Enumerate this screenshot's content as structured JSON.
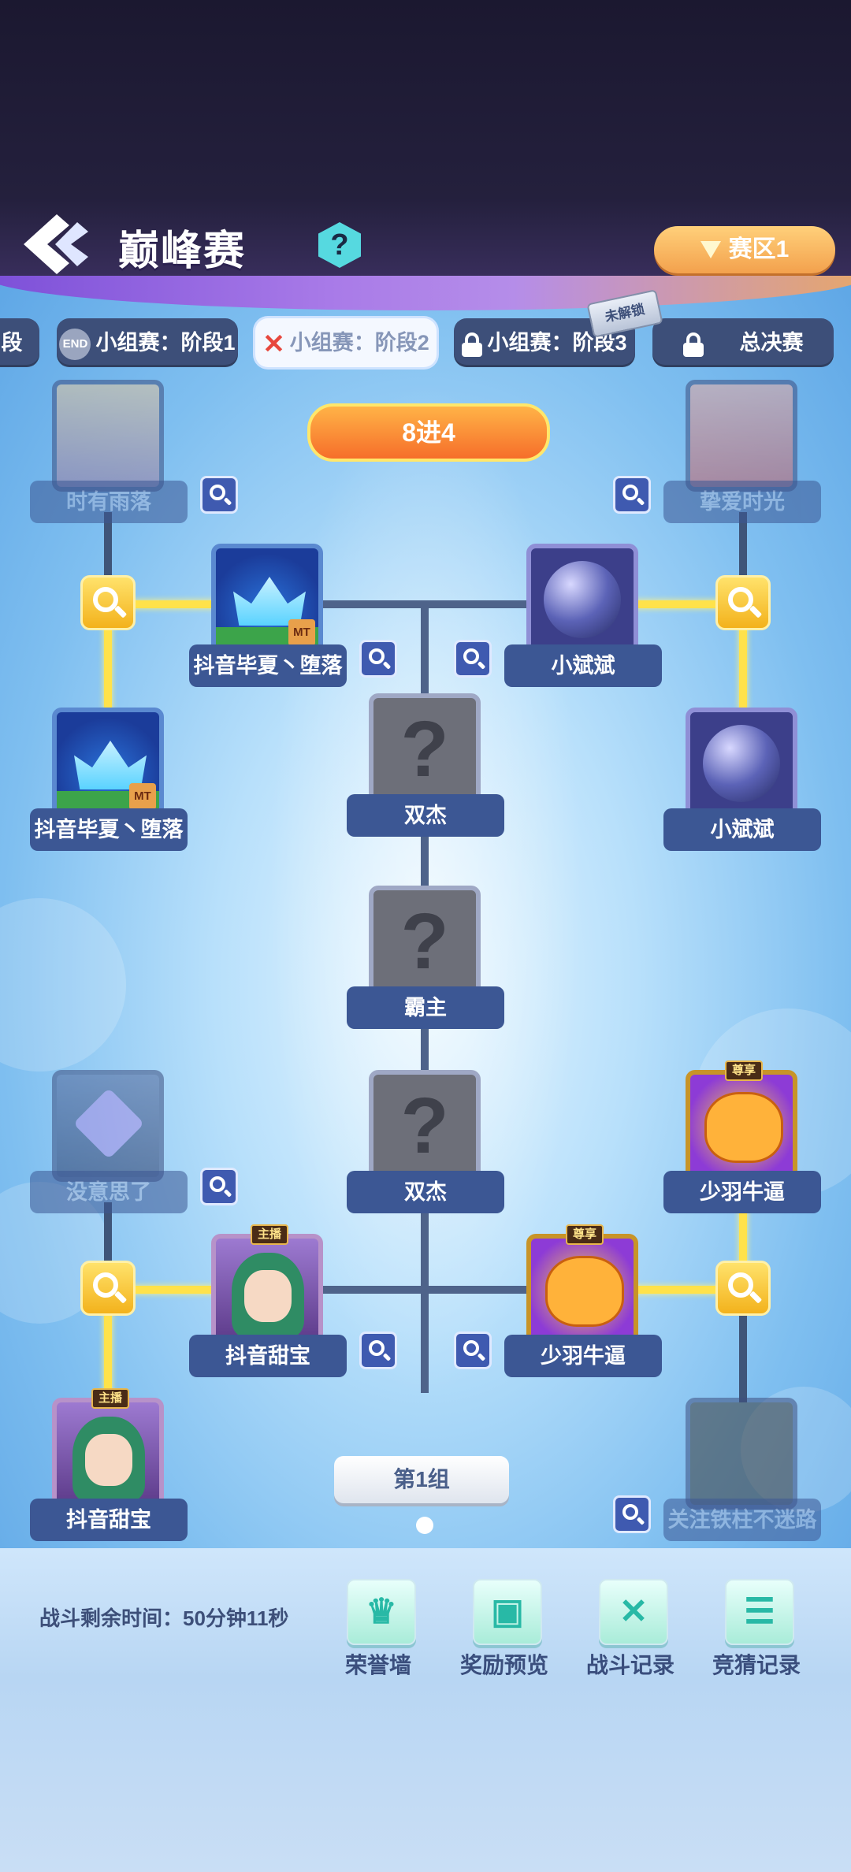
{
  "header": {
    "title": "巅峰赛",
    "help_icon": "?",
    "zone_label": "赛区1"
  },
  "tabs": [
    {
      "label": "段"
    },
    {
      "label": "小组赛：阶段1",
      "badge": "END"
    },
    {
      "label": "小组赛：阶段2"
    },
    {
      "label": "小组赛：阶段3"
    },
    {
      "label": "总决赛"
    }
  ],
  "unlock_tag": "未解锁",
  "round_label": "8进4",
  "bracket": {
    "top_left_r1": "时有雨落",
    "top_right_r1": "挚爱时光",
    "left_r2_top": "抖音毕夏丶堕落",
    "right_r2_top": "小斌斌",
    "left_r1_b": "抖音毕夏丶堕落",
    "right_r1_b": "小斌斌",
    "center_1": "双杰",
    "center_final": "霸主",
    "center_2": "双杰",
    "bl_r1_a": "没意思了",
    "br_r1_a": "少羽牛逼",
    "left_r2_bottom": "抖音甜宝",
    "right_r2_bottom": "少羽牛逼",
    "bl_r1_b": "抖音甜宝",
    "br_r1_b": "关注铁柱不迷路",
    "question_mark": "?",
    "badge_host": "主播",
    "badge_vip": "尊享",
    "badge_mt": "MT"
  },
  "group_label": "第1组",
  "footer": {
    "timer": "战斗剩余时间：50分钟11秒",
    "actions": [
      {
        "label": "荣誉墙",
        "icon": "trophy-icon"
      },
      {
        "label": "奖励预览",
        "icon": "gift-icon"
      },
      {
        "label": "战斗记录",
        "icon": "crossed-swords-icon"
      },
      {
        "label": "竞猜记录",
        "icon": "notes-icon"
      }
    ]
  },
  "colors": {
    "accent_gold": "#ffe24a",
    "tab_bg": "#3d4f79",
    "zone_orange": "#f3a14d",
    "round_orange": "#f66e2a"
  }
}
